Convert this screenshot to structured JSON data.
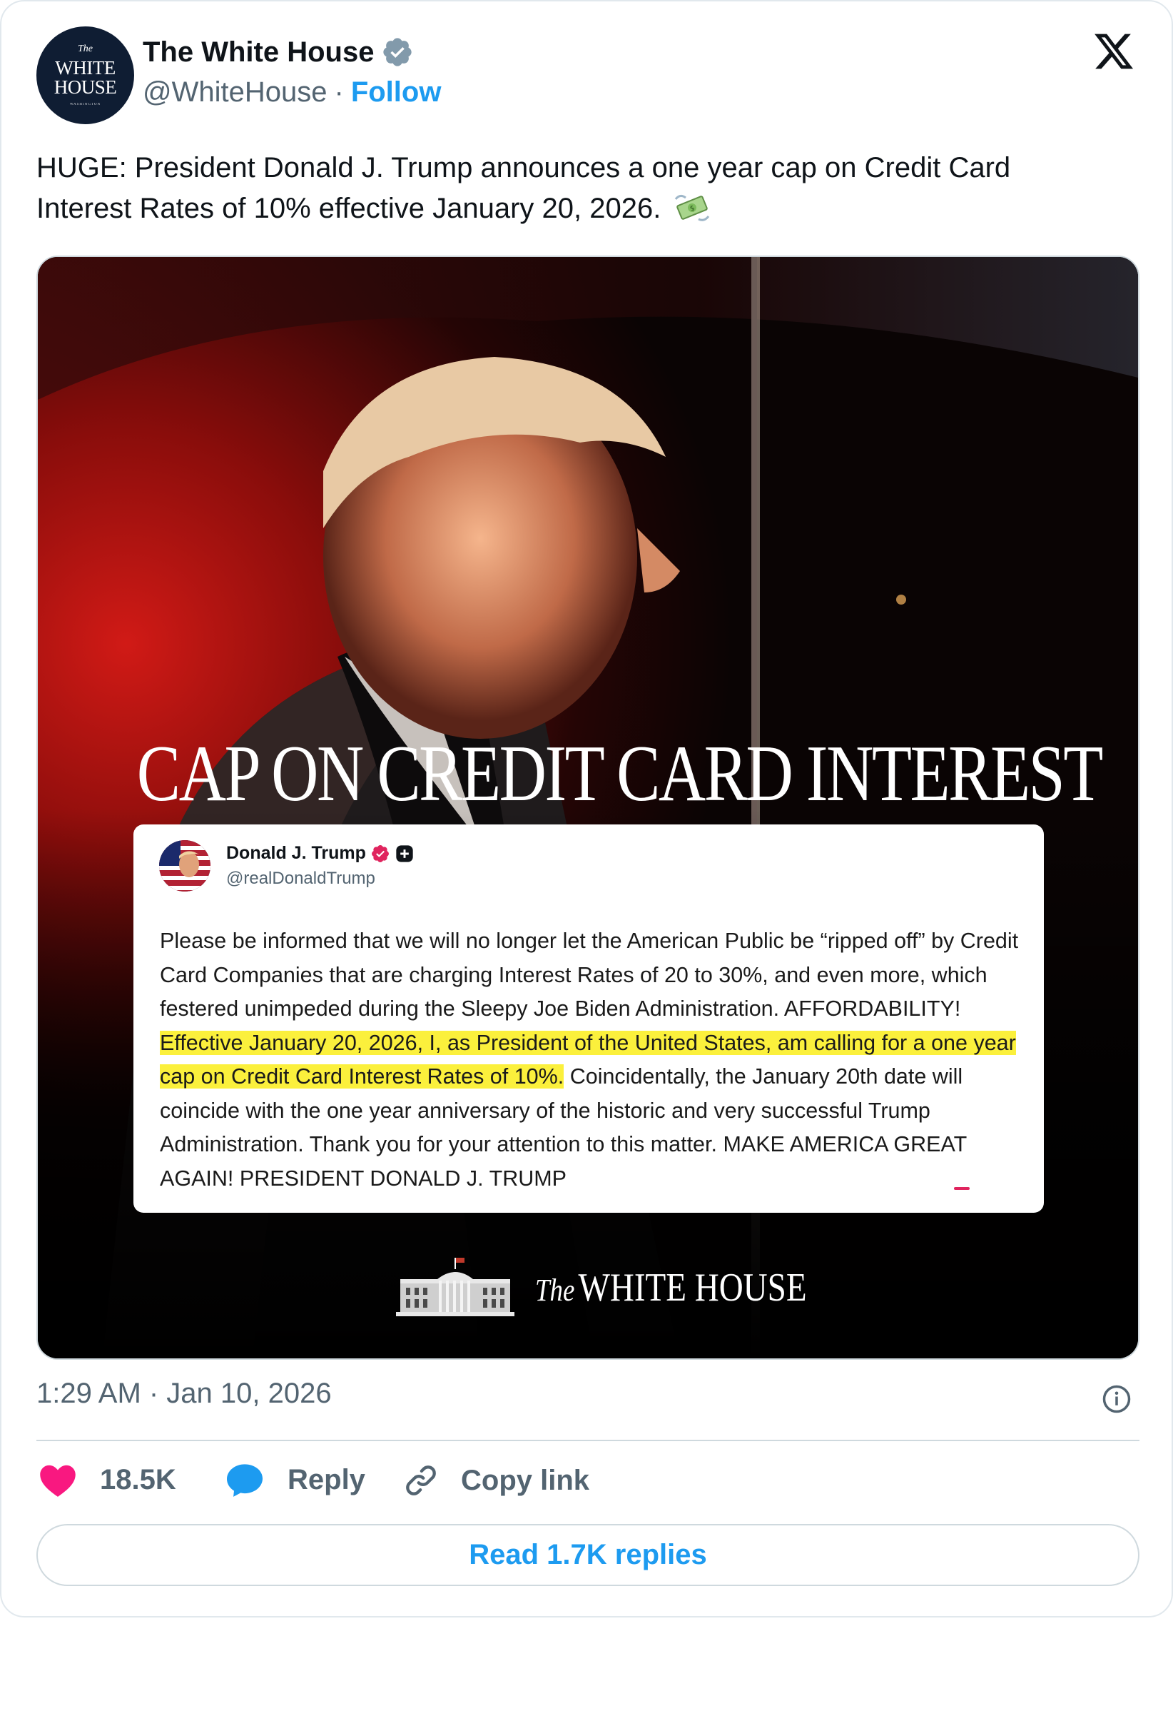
{
  "author": {
    "display_name": "The White House",
    "handle": "@WhiteHouse",
    "separator": "·",
    "follow_label": "Follow",
    "avatar_text": {
      "the": "The",
      "line1": "WHITE",
      "line2": "HOUSE",
      "sub": "WASHINGTON"
    },
    "verified": true,
    "verified_icon": "verified-badge-icon"
  },
  "platform_icon": "x-logo-icon",
  "tweet": {
    "text": "HUGE: President Donald J. Trump announces a one year cap on Credit Card Interest Rates of 10% effective January 20, 2026.",
    "emoji_icon": "money-with-wings-icon"
  },
  "media": {
    "headline": "CAP ON CREDIT CARD INTEREST",
    "quoted_post": {
      "author_name": "Donald J. Trump",
      "author_handle": "@realDonaldTrump",
      "body_before": "Please be informed that we will no longer let the American Public be “ripped off” by Credit Card Companies that are charging Interest Rates of 20 to 30%, and even more, which festered unimpeded during the Sleepy Joe Biden Administration. AFFORDABILITY! ",
      "body_highlight": "Effective January 20, 2026, I, as President of the United States, am calling for a one year cap on Credit Card Interest Rates of 10%.",
      "body_after": " Coincidentally, the January 20th date will coincide with the one year anniversary of the historic and very successful Trump Administration. Thank you for your attention to this matter. MAKE AMERICA GREAT AGAIN! PRESIDENT DONALD J. TRUMP",
      "highlight_color": "#fbf03c"
    },
    "footer_logo": {
      "the": "The",
      "name": "WHITE HOUSE"
    }
  },
  "timestamp": "1:29 AM · Jan 10, 2026",
  "actions": {
    "like_count": "18.5K",
    "reply_label": "Reply",
    "copy_link_label": "Copy link"
  },
  "read_replies_label": "Read 1.7K replies",
  "colors": {
    "accent": "#1d9bf0",
    "like": "#f91880",
    "reply": "#1d9bf0",
    "text": "#0f1419",
    "muted": "#536471"
  }
}
